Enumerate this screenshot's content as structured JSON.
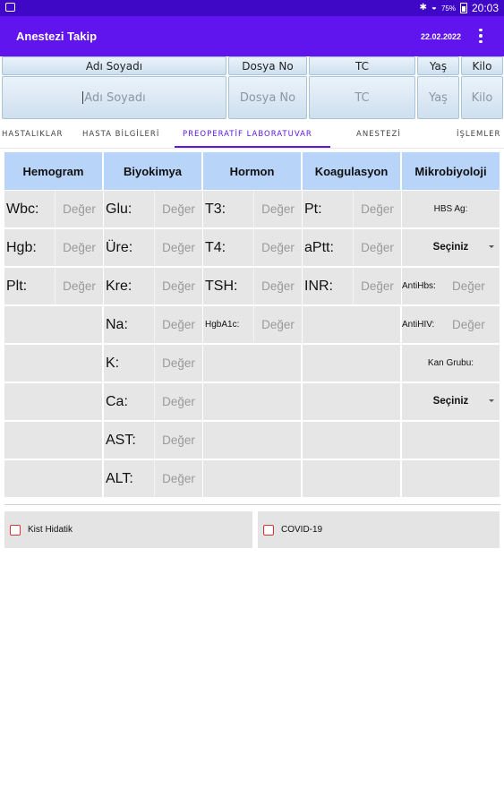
{
  "status_bar": {
    "time": "20:03",
    "battery": "75%"
  },
  "app": {
    "title": "Anestezi Takip",
    "date": "22.02.2022"
  },
  "patient_header": {
    "fields": [
      {
        "label": "Adı Soyadı",
        "placeholder": "Adı Soyadı"
      },
      {
        "label": "Dosya No",
        "placeholder": "Dosya No"
      },
      {
        "label": "TC",
        "placeholder": "TC"
      },
      {
        "label": "Yaş",
        "placeholder": "Yaş"
      },
      {
        "label": "Kilo",
        "placeholder": "Kilo"
      }
    ]
  },
  "tabs": [
    {
      "label": "HASTALIKLAR"
    },
    {
      "label": "HASTA BİLGİLERİ"
    },
    {
      "label": "PREOPERATİF LABORATUVAR"
    },
    {
      "label": "ANESTEZİ"
    },
    {
      "label": "İŞLEMLER"
    }
  ],
  "value_placeholder": "Değer",
  "lab": {
    "hemogram": {
      "title": "Hemogram",
      "rows": [
        {
          "label": "Wbc:"
        },
        {
          "label": "Hgb:"
        },
        {
          "label": "Plt:"
        }
      ]
    },
    "biyokimya": {
      "title": "Biyokimya",
      "rows": [
        {
          "label": "Glu:"
        },
        {
          "label": "Üre:"
        },
        {
          "label": "Kre:"
        },
        {
          "label": "Na:"
        },
        {
          "label": "K:"
        },
        {
          "label": "Ca:"
        },
        {
          "label": "AST:"
        },
        {
          "label": "ALT:"
        }
      ]
    },
    "hormon": {
      "title": "Hormon",
      "rows": [
        {
          "label": "T3:"
        },
        {
          "label": "T4:"
        },
        {
          "label": "TSH:"
        },
        {
          "label": "HgbA1c:"
        }
      ]
    },
    "koagulasyon": {
      "title": "Koagulasyon",
      "rows": [
        {
          "label": "Pt:"
        },
        {
          "label": "aPtt:"
        },
        {
          "label": "INR:"
        }
      ]
    },
    "mikrobiyoloji": {
      "title": "Mikrobiyoloji",
      "hbs_ag_label": "HBS Ag:",
      "hbs_ag_select": "Seçiniz",
      "antihbs_label": "AntiHbs:",
      "antihiv_label": "AntiHIV:",
      "kan_grubu_label": "Kan Grubu:",
      "kan_grubu_select": "Seçiniz"
    }
  },
  "checkboxes": [
    {
      "label": "Kist Hidatik"
    },
    {
      "label": "COVID-19"
    }
  ],
  "colors": {
    "status_bar": "#3f07c6",
    "app_bar": "#6115ee",
    "accent": "#5a18e0",
    "lab_header": "#b8d4f8",
    "checkbox_border": "#d33333"
  }
}
